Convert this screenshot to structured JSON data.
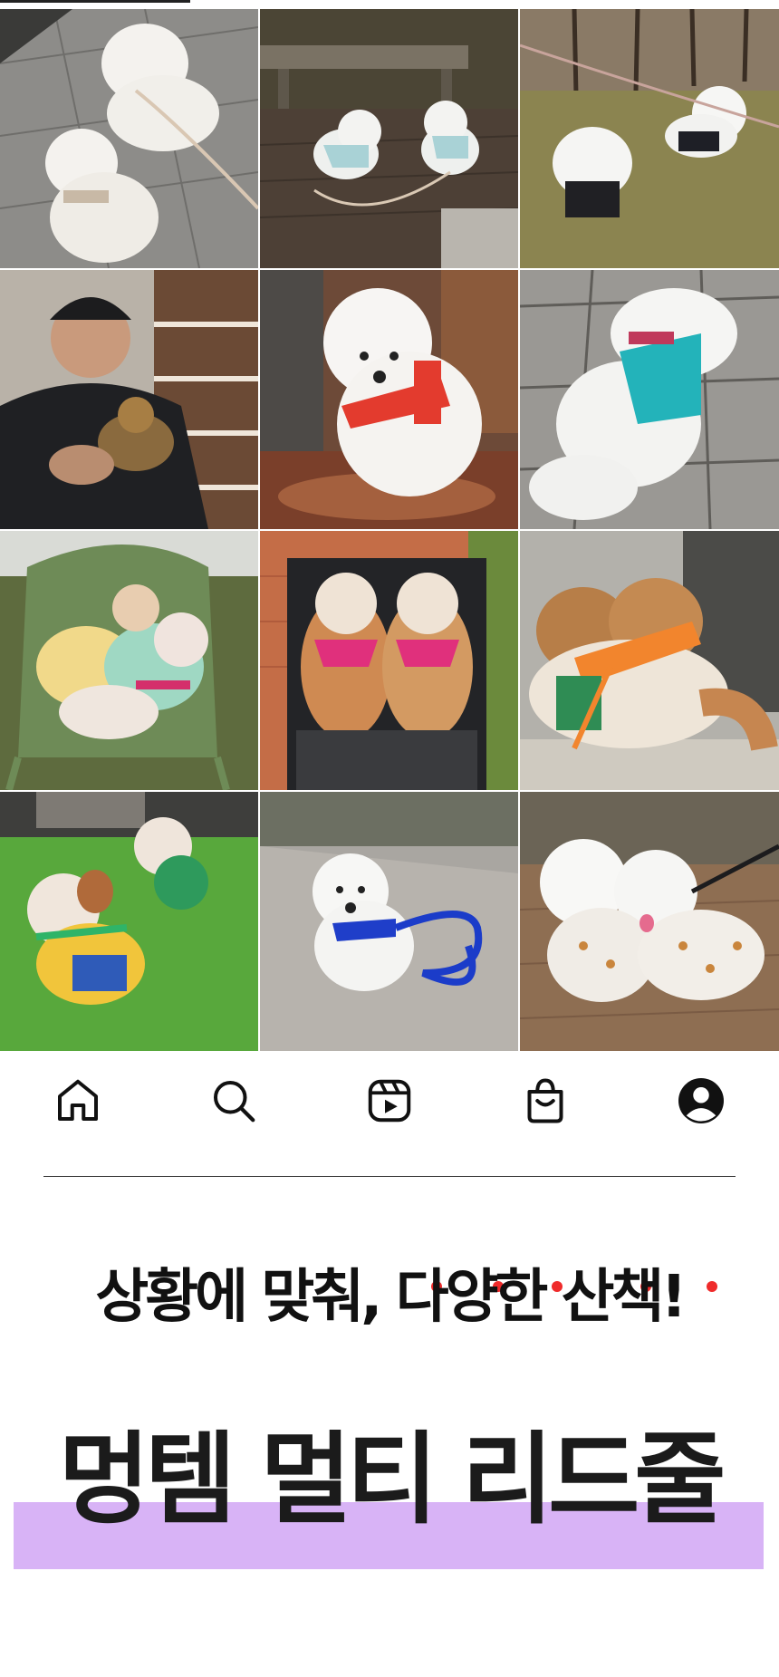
{
  "grid": {
    "photos": [
      {
        "name": "photo-two-bichons-on-pavement",
        "alt": "two white bichons in harnesses on stone tiles"
      },
      {
        "name": "photo-bichons-on-deck",
        "alt": "two bichons on wooden deck near bench"
      },
      {
        "name": "photo-bichons-on-grass",
        "alt": "two bichons in black outfits on grass"
      },
      {
        "name": "photo-man-holding-yorkie",
        "alt": "man in black jacket holding small dog"
      },
      {
        "name": "photo-bichon-red-harness",
        "alt": "bichon wearing red harness on bench"
      },
      {
        "name": "photo-bichon-teal-shirt",
        "alt": "bichon in teal shirt on pavement"
      },
      {
        "name": "photo-dogs-on-green-chair",
        "alt": "dogs sitting on green chair"
      },
      {
        "name": "photo-shih-tzus-in-stroller",
        "alt": "two shih tzus in stroller with pink harnesses"
      },
      {
        "name": "photo-shih-tzus-orange-harness",
        "alt": "two shih tzus with orange harnesses"
      },
      {
        "name": "photo-shih-tzus-on-lawn",
        "alt": "two shih tzus running on lawn"
      },
      {
        "name": "photo-bichon-blue-leash",
        "alt": "bichon with blue leash on pavement"
      },
      {
        "name": "photo-bichons-printed-outfits",
        "alt": "two bichons in printed outfits"
      }
    ]
  },
  "nav": {
    "items": [
      {
        "name": "nav-home",
        "icon": "home-icon"
      },
      {
        "name": "nav-search",
        "icon": "search-icon"
      },
      {
        "name": "nav-reels",
        "icon": "reels-icon"
      },
      {
        "name": "nav-shop",
        "icon": "shopping-bag-icon"
      },
      {
        "name": "nav-profile",
        "icon": "profile-icon"
      }
    ]
  },
  "headline": "상황에 맞춰, 다양한 산책!",
  "title": "멍템 멀티 리드줄",
  "colors": {
    "accent_dot": "#ef2b2b",
    "highlight": "#d8b3f6"
  }
}
